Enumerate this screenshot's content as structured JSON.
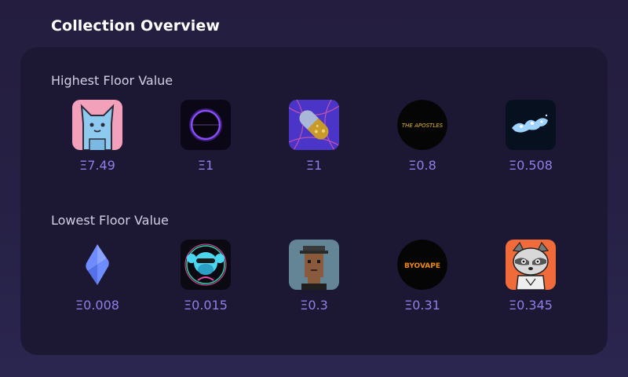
{
  "header": {
    "title": "Collection Overview"
  },
  "highest": {
    "label": "Highest Floor Value",
    "items": [
      {
        "price": "Ξ7.49",
        "icon": "blue-cat-nft-icon"
      },
      {
        "price": "Ξ1",
        "icon": "purple-ring-nft-icon"
      },
      {
        "price": "Ξ1",
        "icon": "gold-capsule-nft-icon"
      },
      {
        "price": "Ξ0.8",
        "icon": "the-apostles-logo-icon",
        "logo_text": "THE APOSTLES"
      },
      {
        "price": "Ξ0.508",
        "icon": "blue-splash-nft-icon"
      }
    ]
  },
  "lowest": {
    "label": "Lowest Floor Value",
    "items": [
      {
        "price": "Ξ0.008",
        "icon": "ens-logo-icon"
      },
      {
        "price": "Ξ0.015",
        "icon": "neon-ape-nft-icon"
      },
      {
        "price": "Ξ0.3",
        "icon": "pixel-punk-nft-icon"
      },
      {
        "price": "Ξ0.31",
        "icon": "byovape-logo-icon",
        "logo_text": "BYOVAPE"
      },
      {
        "price": "Ξ0.345",
        "icon": "raccoon-nft-icon"
      }
    ]
  },
  "colors": {
    "accent": "#8f7fe8",
    "panel": "#1c1834",
    "background": "#241d3f"
  }
}
